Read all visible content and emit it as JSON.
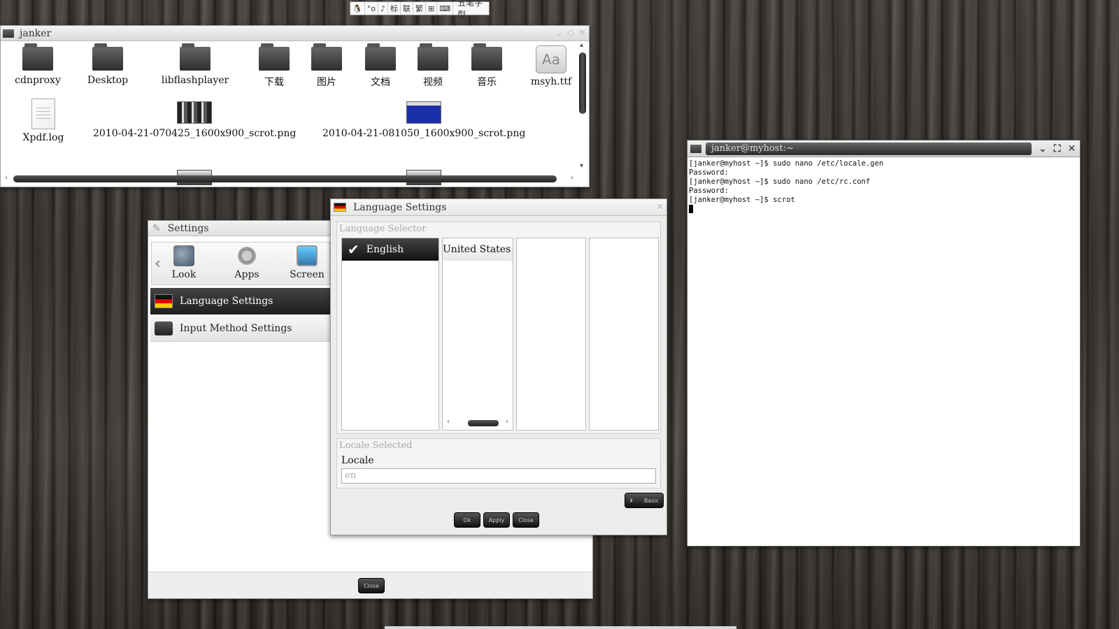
{
  "ime_bar": {
    "segments": [
      "🐧",
      "°o",
      "♪",
      "标",
      "联",
      "繁",
      "⊞",
      "⌨"
    ],
    "mode": "五笔字型"
  },
  "file_manager": {
    "title": "janker",
    "items": [
      {
        "label": "cdnproxy",
        "type": "folder"
      },
      {
        "label": "Desktop",
        "type": "folder"
      },
      {
        "label": "libflashplayer",
        "type": "folder"
      },
      {
        "label": "下载",
        "type": "folder"
      },
      {
        "label": "图片",
        "type": "folder"
      },
      {
        "label": "文档",
        "type": "folder"
      },
      {
        "label": "视频",
        "type": "folder"
      },
      {
        "label": "音乐",
        "type": "folder"
      },
      {
        "label": "msyh.ttf",
        "type": "font"
      },
      {
        "label": "Xpdf.log",
        "type": "document"
      },
      {
        "label": "2010-04-21-070425_1600x900_scrot.png",
        "type": "image"
      },
      {
        "label": "2010-04-21-081050_1600x900_scrot.png",
        "type": "image"
      }
    ],
    "font_icon_glyph": "Aa"
  },
  "settings": {
    "title": "Settings",
    "categories": [
      "Look",
      "Apps",
      "Screen"
    ],
    "menu": [
      "Language Settings",
      "Input Method Settings"
    ],
    "close_label": "Close"
  },
  "language_dialog": {
    "title": "Language Settings",
    "selector_label": "Language Selector",
    "language": "English",
    "country": "United States",
    "locale_group_label": "Locale Selected",
    "locale_label": "Locale",
    "locale_value": "en",
    "basic_label": "Basic",
    "ok_label": "Ok",
    "apply_label": "Apply",
    "close_label": "Close"
  },
  "terminal": {
    "title": "janker@myhost:~",
    "lines": [
      "[janker@myhost ~]$ sudo nano /etc/locale.gen",
      "Password:",
      "[janker@myhost ~]$ sudo nano /etc/rc.conf",
      "Password:",
      "[janker@myhost ~]$ scrot"
    ]
  }
}
